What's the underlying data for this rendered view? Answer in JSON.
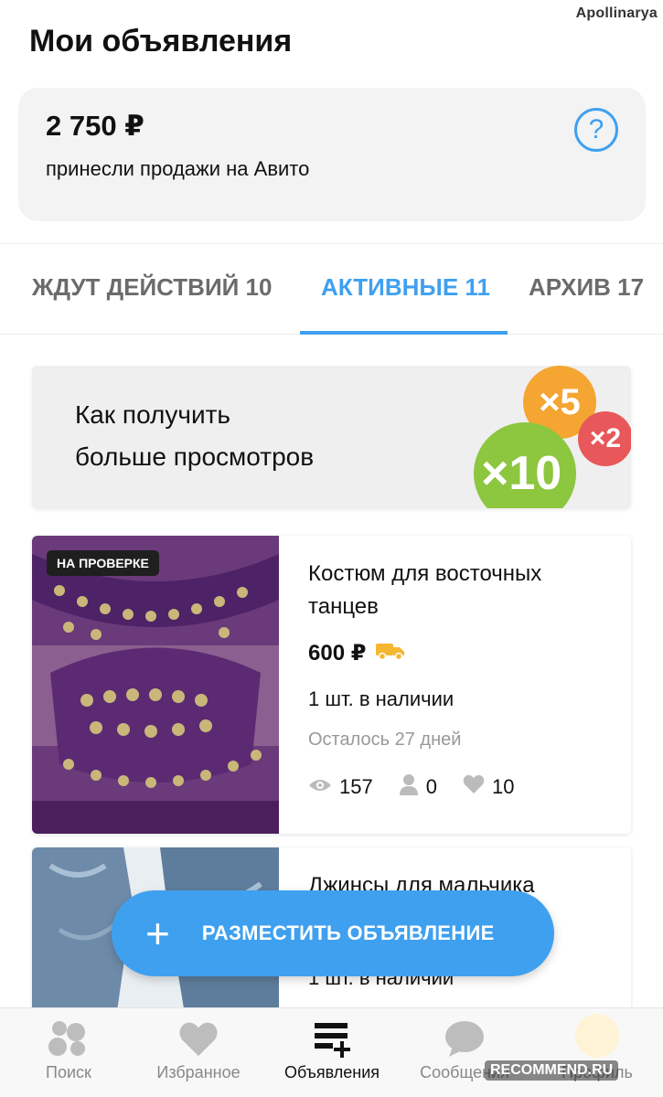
{
  "watermark_user": "Apollinarya",
  "page_title": "Мои объявления",
  "sales": {
    "amount": "2 750 ₽",
    "text": "принесли продажи на Авито"
  },
  "tabs": [
    {
      "label": "ЖДУТ ДЕЙСТВИЙ 10",
      "active": false
    },
    {
      "label": "АКТИВНЫЕ 11",
      "active": true
    },
    {
      "label": "АРХИВ 17",
      "active": false
    }
  ],
  "promo": {
    "line1": "Как получить",
    "line2": "больше просмотров",
    "badges": [
      "×5",
      "×2",
      "×10"
    ]
  },
  "listings": [
    {
      "status": "НА ПРОВЕРКЕ",
      "title": "Костюм для восточных танцев",
      "price": "600 ₽",
      "stock": "1 шт. в наличии",
      "days_left": "Осталось 27 дней",
      "views": "157",
      "contacts": "0",
      "favorites": "10"
    },
    {
      "title": "Джинсы для мальчика",
      "stock": "1 шт. в наличии"
    }
  ],
  "fab": {
    "plus": "+",
    "label": "РАЗМЕСТИТЬ ОБЪЯВЛЕНИЕ"
  },
  "nav": [
    {
      "label": "Поиск",
      "icon": "search-icon",
      "active": false
    },
    {
      "label": "Избранное",
      "icon": "heart-icon",
      "active": false
    },
    {
      "label": "Объявления",
      "icon": "listings-add-icon",
      "active": true
    },
    {
      "label": "Сообщения",
      "icon": "chat-icon",
      "active": false
    },
    {
      "label": "Профиль",
      "icon": "avatar-icon",
      "active": false
    }
  ],
  "watermark_site": "RECOMMEND.RU",
  "colors": {
    "accent": "#3fa0f0",
    "badge_orange": "#f5a531",
    "badge_red": "#e8575a",
    "badge_green": "#8dc63f",
    "delivery_truck": "#f5b731"
  }
}
